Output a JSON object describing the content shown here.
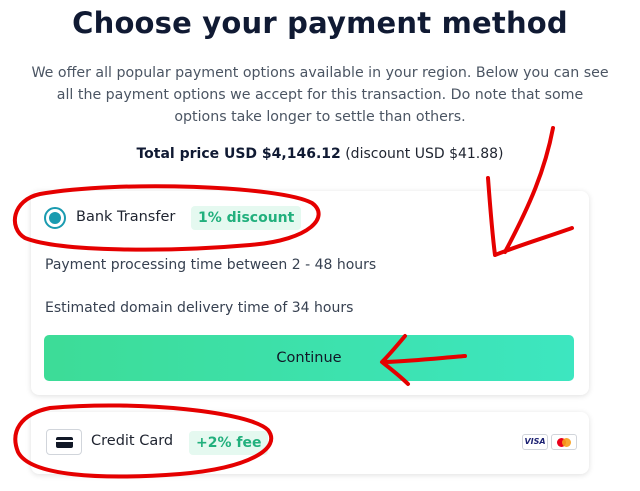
{
  "page": {
    "title": "Choose your payment method",
    "description": "We offer all popular payment options available in your region. Below you can see all the payment options we accept for this transaction. Do note that some options take longer to settle than others.",
    "total_label": "Total price USD $4,146.12",
    "total_discount": "(discount USD $41.88)"
  },
  "bank_transfer": {
    "label": "Bank Transfer",
    "badge": "1% discount",
    "selected": true,
    "processing_time": "Payment processing time between 2 - 48 hours",
    "delivery_time": "Estimated domain delivery time of 34 hours",
    "continue_label": "Continue"
  },
  "credit_card": {
    "label": "Credit Card",
    "badge": "+2% fee",
    "card_brands": [
      "VISA",
      "mastercard"
    ]
  },
  "colors": {
    "title": "#101a33",
    "accent_teal": "#1a9bb0",
    "badge_green": "#22b07d",
    "button_start": "#3ddc97",
    "button_end": "#3de6c0",
    "annotation_red": "#e50000"
  },
  "annotations": {
    "color": "#e50000",
    "marks": [
      "ellipse-bank-transfer",
      "ellipse-credit-card",
      "arrow-to-card",
      "arrow-to-continue"
    ]
  }
}
